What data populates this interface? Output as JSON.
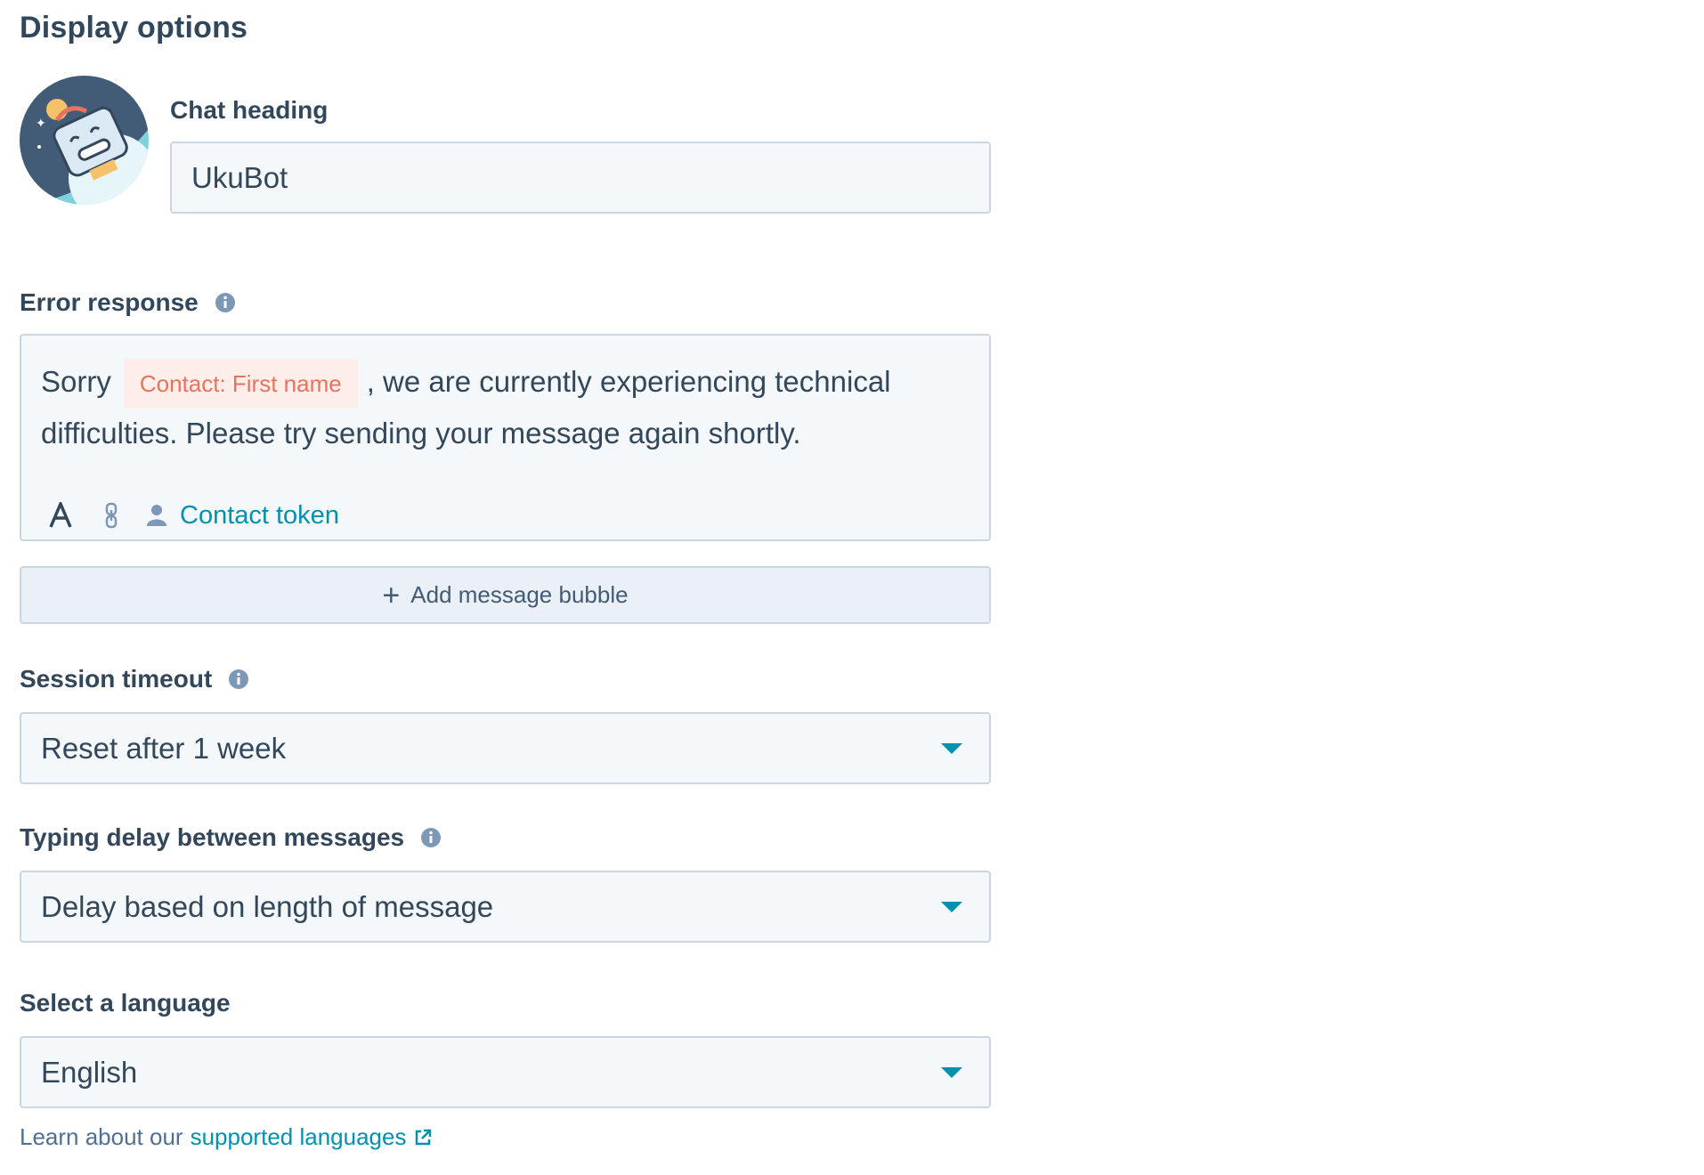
{
  "section": {
    "title": "Display options"
  },
  "chat_heading": {
    "label": "Chat heading",
    "value": "UkuBot"
  },
  "error_response": {
    "label": "Error response",
    "text_before": "Sorry",
    "token": "Contact: First name",
    "text_after": ", we are currently experiencing technical difficulties. Please try sending your message again shortly.",
    "toolbar": {
      "contact_token_label": "Contact token"
    }
  },
  "add_bubble": {
    "label": "Add message bubble"
  },
  "session_timeout": {
    "label": "Session timeout",
    "value": "Reset after 1 week"
  },
  "typing_delay": {
    "label": "Typing delay between messages",
    "value": "Delay based on length of message"
  },
  "language": {
    "label": "Select a language",
    "value": "English"
  },
  "help": {
    "text": "Learn about our",
    "link": "supported languages"
  },
  "colors": {
    "accent": "#0091ae",
    "token_bg": "#fdeee9",
    "token_text": "#e8735d",
    "text": "#33475b",
    "border": "#cbd6e2"
  }
}
